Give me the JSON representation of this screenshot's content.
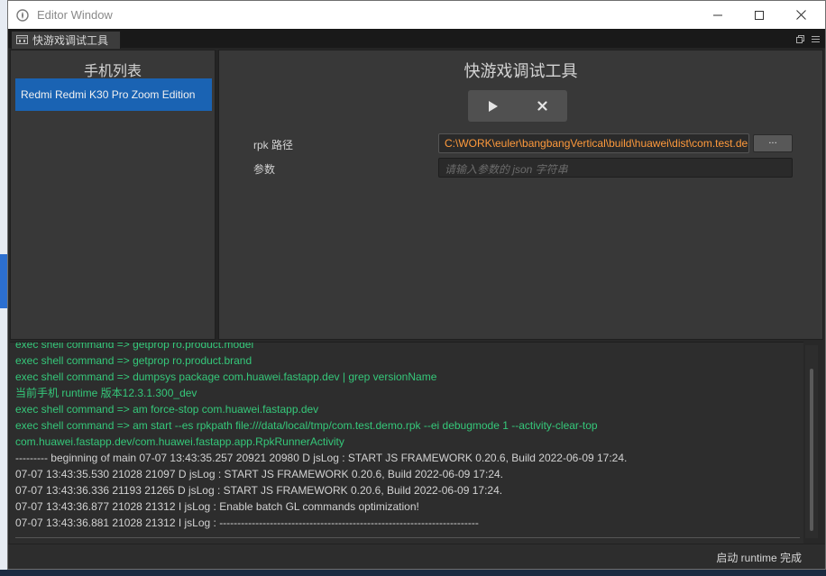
{
  "window": {
    "title": "Editor Window"
  },
  "tab": {
    "label": "快游戏调试工具"
  },
  "left_panel": {
    "heading": "手机列表",
    "devices": [
      "Redmi Redmi K30 Pro Zoom Edition"
    ]
  },
  "right_panel": {
    "heading": "快游戏调试工具",
    "rpk_label": "rpk 路径",
    "rpk_value": "C:\\WORK\\euler\\bangbangVertical\\build\\huawei\\dist\\com.test.demo.rpk",
    "params_label": "参数",
    "params_placeholder": "请输入参数的 json 字符串",
    "browse_label": "···"
  },
  "console": {
    "lines": [
      {
        "text": "exec shell command => getprop ro.product.model",
        "color": "green"
      },
      {
        "text": "exec shell command => getprop ro.product.brand",
        "color": "green"
      },
      {
        "text": "exec shell command => dumpsys package com.huawei.fastapp.dev | grep versionName",
        "color": "green"
      },
      {
        "text": "当前手机 runtime 版本12.3.1.300_dev",
        "color": "green"
      },
      {
        "text": "exec shell command => am force-stop com.huawei.fastapp.dev",
        "color": "green"
      },
      {
        "text": "exec shell command => am start --es rpkpath file:///data/local/tmp/com.test.demo.rpk --ei debugmode 1 --activity-clear-top",
        "color": "green"
      },
      {
        "text": "com.huawei.fastapp.dev/com.huawei.fastapp.app.RpkRunnerActivity",
        "color": "green"
      },
      {
        "text": "--------- beginning of main 07-07 13:43:35.257 20921 20980 D jsLog : START JS FRAMEWORK 0.20.6, Build 2022-06-09 17:24.",
        "color": "white"
      },
      {
        "text": "07-07 13:43:35.530 21028 21097 D jsLog : START JS FRAMEWORK 0.20.6, Build 2022-06-09 17:24.",
        "color": "white"
      },
      {
        "text": "07-07 13:43:36.336 21193 21265 D jsLog : START JS FRAMEWORK 0.20.6, Build 2022-06-09 17:24.",
        "color": "white"
      },
      {
        "text": "07-07 13:43:36.877 21028 21312 I jsLog : Enable batch GL commands optimization!",
        "color": "white"
      },
      {
        "text": "07-07 13:43:36.881 21028 21312 I jsLog : ------------------------------------------------------------------------",
        "color": "white"
      }
    ]
  },
  "status": {
    "text": "启动 runtime 完成"
  },
  "colors": {
    "accent": "#1a63b3",
    "path_text": "#ff9a3c",
    "console_green": "#35c87a"
  }
}
